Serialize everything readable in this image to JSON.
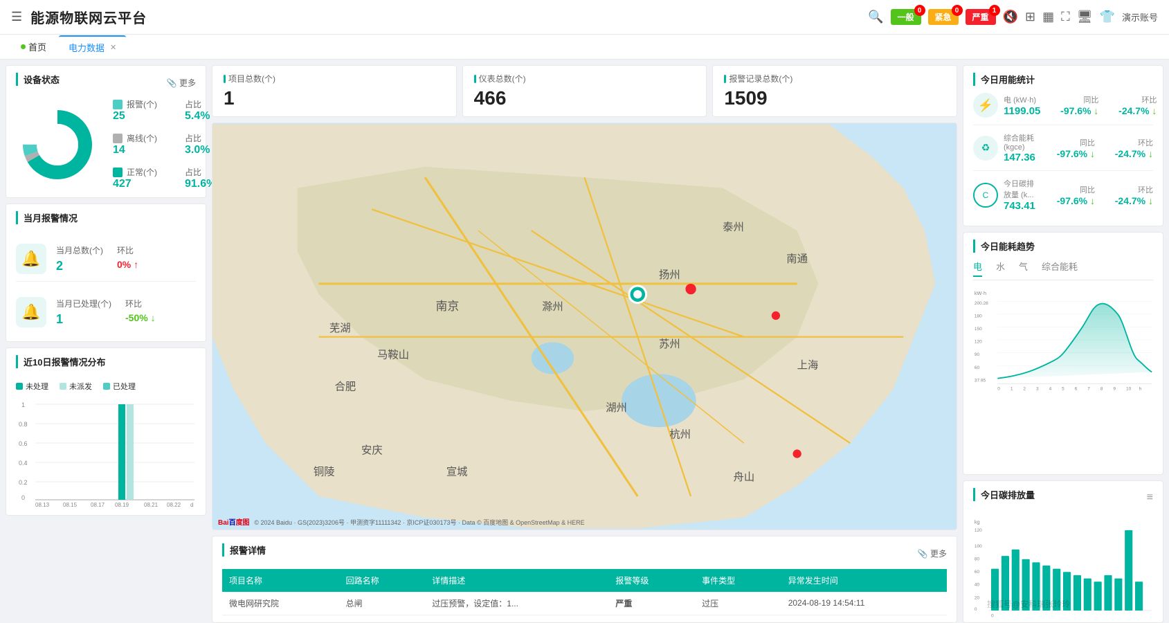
{
  "header": {
    "title": "能源物联网云平台",
    "menu_icon": "☰",
    "nav": {
      "alert_general_label": "一般",
      "alert_general_count": "0",
      "alert_urgent_label": "紧急",
      "alert_urgent_count": "0",
      "alert_severe_label": "严重",
      "alert_severe_count": "1",
      "username": "演示账号"
    }
  },
  "tabs": [
    {
      "label": "首页",
      "active": false,
      "closable": false,
      "dot": true
    },
    {
      "label": "电力数据",
      "active": true,
      "closable": true,
      "dot": false
    }
  ],
  "device_status": {
    "title": "设备状态",
    "more_label": "更多",
    "legend": [
      {
        "label": "报警(个)",
        "color": "#4ecdc4",
        "value": "25",
        "ratio_label": "占比",
        "ratio": "5.4%"
      },
      {
        "label": "离线(个)",
        "color": "#b0b0b0",
        "value": "14",
        "ratio_label": "占比",
        "ratio": "3.0%"
      },
      {
        "label": "正常(个)",
        "color": "#00b5a0",
        "value": "427",
        "ratio_label": "占比",
        "ratio": "91.6%"
      }
    ],
    "donut": {
      "segments": [
        {
          "label": "报警",
          "color": "#4ecdc4",
          "percent": 5.4
        },
        {
          "label": "离线",
          "color": "#b0b0b0",
          "percent": 3.0
        },
        {
          "label": "正常",
          "color": "#00b5a0",
          "percent": 91.6
        }
      ]
    }
  },
  "monthly_alert": {
    "title": "当月报警情况",
    "items": [
      {
        "icon": "🔔",
        "label": "当月总数(个)",
        "value": "2",
        "change_label": "环比",
        "change_value": "0%",
        "change_dir": "up",
        "change_color": "red"
      },
      {
        "icon": "🔔",
        "label": "当月已处理(个)",
        "value": "1",
        "change_label": "环比",
        "change_value": "-50%",
        "change_dir": "down",
        "change_color": "green"
      }
    ]
  },
  "near10days_alert": {
    "title": "近10日报警情况分布",
    "legend": [
      {
        "label": "未处理",
        "color": "#00b5a0"
      },
      {
        "label": "未派发",
        "color": "#b3e5e0"
      },
      {
        "label": "已处理",
        "color": "#4ecdc4"
      }
    ],
    "y_labels": [
      "1",
      "0.8",
      "0.6",
      "0.4",
      "0.2",
      "0"
    ],
    "x_labels": [
      "08.13",
      "08.15",
      "08.17",
      "08.19",
      "08.21",
      "08.22"
    ],
    "x_axis_unit": "d",
    "bars": [
      {
        "date": "08.19",
        "unprocessed": 1,
        "unsent": 1,
        "processed": 0
      }
    ]
  },
  "map_stats": {
    "total_projects_label": "项目总数(个)",
    "total_projects_value": "1",
    "total_meters_label": "仪表总数(个)",
    "total_meters_value": "466",
    "total_alerts_label": "报警记录总数(个)",
    "total_alerts_value": "1509"
  },
  "map": {
    "credit": "© 2024 Baidu · GS(2023)3206号 · 甲测资字11111342 · 京ICP证030173号 · Data © 百度地图 & OpenStreetMap & HERE",
    "baidu_logo": "Bai du 地图"
  },
  "alert_detail": {
    "title": "报警详情",
    "more_label": "更多",
    "columns": [
      "项目名称",
      "回路名称",
      "详情描述",
      "报警等级",
      "事件类型",
      "异常发生时间"
    ],
    "rows": [
      {
        "project": "微电网研究院",
        "circuit": "总闸",
        "description": "过压预警，设定值：1...",
        "severity": "严重",
        "event_type": "过压",
        "time": "2024-08-19 14:54:11"
      }
    ]
  },
  "energy_today": {
    "title": "今日用能统计",
    "items": [
      {
        "icon": "⚡",
        "label": "电 (kW·h)",
        "value": "1199.05",
        "compare_yoy_label": "同比",
        "compare_yoy_value": "-97.6%",
        "compare_mom_label": "环比",
        "compare_mom_value": "-24.7%"
      },
      {
        "icon": "♻",
        "label": "综合能耗 (kgce)",
        "value": "147.36",
        "compare_yoy_label": "同比",
        "compare_yoy_value": "-97.6%",
        "compare_mom_label": "环比",
        "compare_mom_value": "-24.7%"
      },
      {
        "icon": "©",
        "label": "今日碳排放量 (k...",
        "value": "743.41",
        "compare_yoy_label": "同比",
        "compare_yoy_value": "-97.6%",
        "compare_mom_label": "环比",
        "compare_mom_value": "-24.7%"
      }
    ]
  },
  "energy_trend": {
    "title": "今日能耗趋势",
    "tabs": [
      "电",
      "水",
      "气",
      "综合能耗"
    ],
    "active_tab": "电",
    "y_label": "kW·h",
    "y_values": [
      "200.28",
      "180",
      "150",
      "120",
      "90",
      "60",
      "37.95"
    ],
    "x_values": [
      "0",
      "1",
      "2",
      "3",
      "4",
      "5",
      "6",
      "7",
      "8",
      "9",
      "10"
    ],
    "x_unit": "h"
  },
  "carbon_today": {
    "title": "今日碳排放量",
    "y_unit": "kg",
    "y_max": "120",
    "bar_color": "#00b5a0"
  },
  "watermark": "搜狐号@安科瑞张玲玲"
}
